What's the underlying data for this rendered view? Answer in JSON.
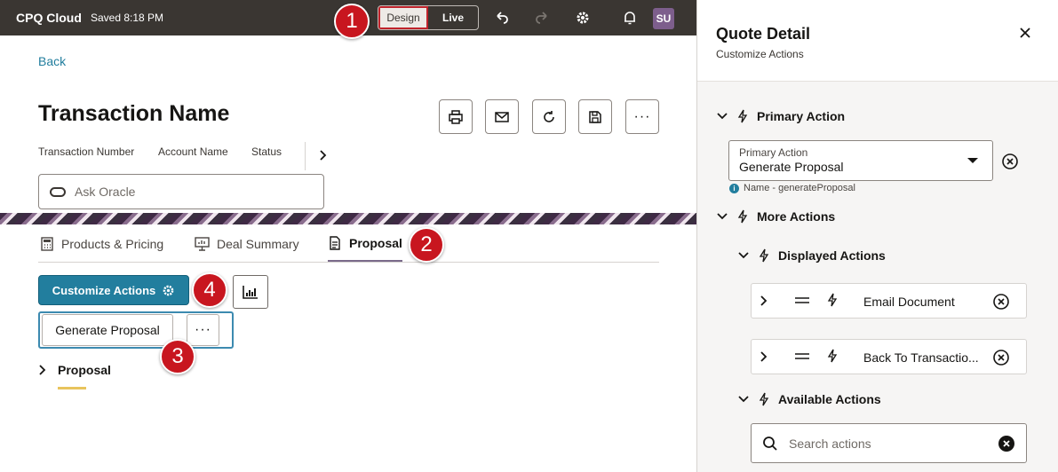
{
  "topbar": {
    "brand": "CPQ Cloud",
    "saved": "Saved 8:18 PM",
    "design": "Design",
    "live": "Live",
    "avatar": "SU"
  },
  "page": {
    "back": "Back",
    "title": "Transaction Name",
    "meta": [
      "Transaction Number",
      "Account Name",
      "Status"
    ],
    "ask_placeholder": "Ask Oracle",
    "tabs": [
      "Products & Pricing",
      "Deal Summary",
      "Proposal"
    ],
    "customize": "Customize Actions",
    "generate": "Generate Proposal",
    "more": "···",
    "section": "Proposal",
    "badges": [
      "1",
      "2",
      "3",
      "4"
    ]
  },
  "panel": {
    "title": "Quote Detail",
    "subtitle": "Customize Actions",
    "primary_header": "Primary Action",
    "select_label": "Primary Action",
    "select_value": "Generate Proposal",
    "help": "Name - generateProposal",
    "more_header": "More Actions",
    "displayed_header": "Displayed Actions",
    "displayed": [
      "Email Document",
      "Back To Transactio..."
    ],
    "available_header": "Available Actions",
    "search_placeholder": "Search actions"
  }
}
